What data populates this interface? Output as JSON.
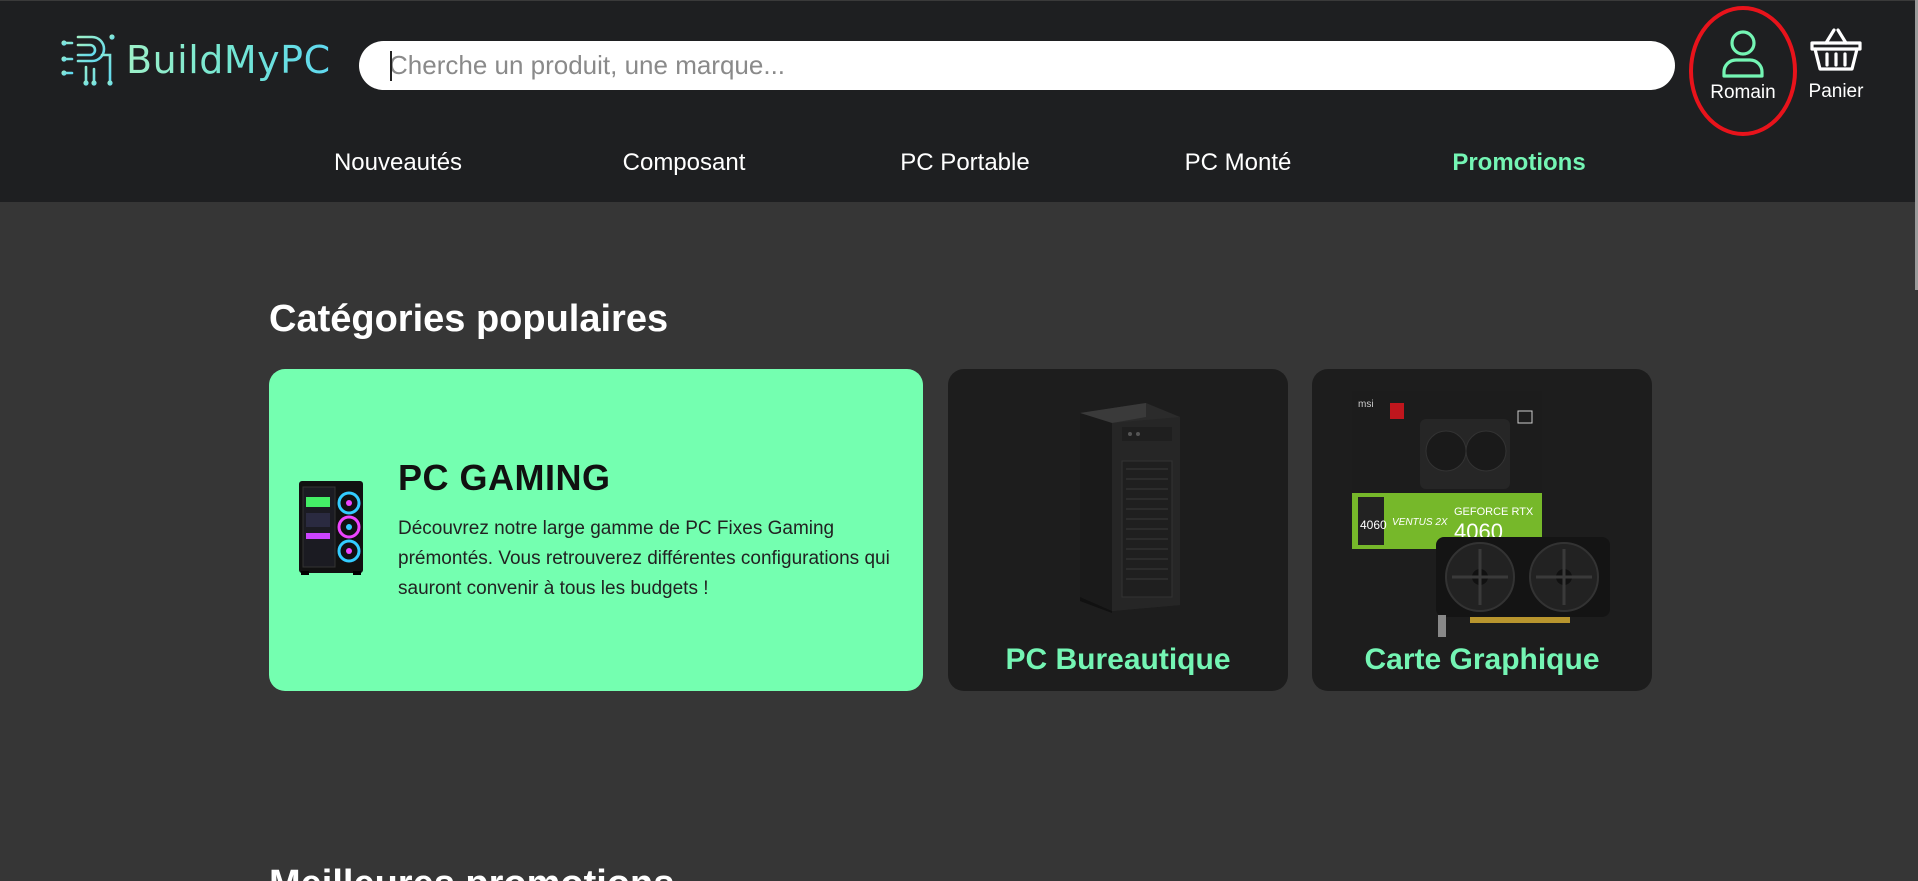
{
  "header": {
    "logo_text": "BuildMyPC",
    "search": {
      "placeholder": "Cherche un produit, une marque...",
      "value": ""
    },
    "user": {
      "label": "Romain",
      "icon": "user-icon"
    },
    "cart": {
      "label": "Panier",
      "icon": "basket-icon"
    },
    "nav": [
      {
        "label": "Nouveautés"
      },
      {
        "label": "Composant"
      },
      {
        "label": "PC Portable"
      },
      {
        "label": "PC Monté"
      },
      {
        "label": "Promotions"
      }
    ]
  },
  "main": {
    "section_title": "Catégories populaires",
    "categories": [
      {
        "title": "PC GAMING",
        "description": "Découvrez notre large gamme de PC Fixes Gaming prémontés. Vous retrouverez différentes configurations qui sauront convenir à tous les budgets !"
      },
      {
        "title": "PC Bureautique"
      },
      {
        "title": "Carte Graphique"
      }
    ],
    "next_section_title": "Meilleures promotions"
  },
  "colors": {
    "accent": "#74f5b4",
    "header_bg": "#1e1f21",
    "page_bg": "#363636",
    "highlight_ring": "#e8131b"
  }
}
